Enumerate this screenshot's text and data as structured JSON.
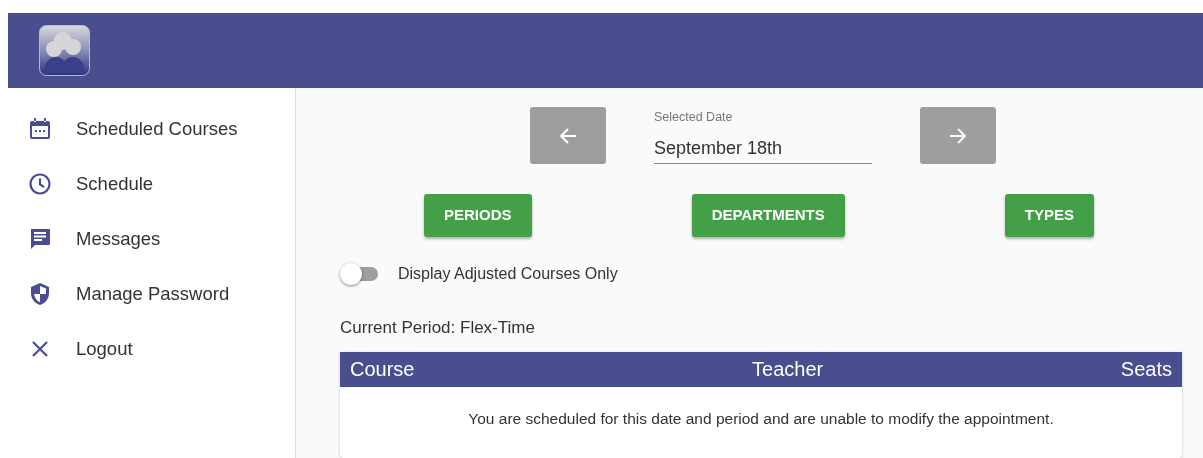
{
  "sidebar": {
    "items": [
      {
        "label": "Scheduled Courses"
      },
      {
        "label": "Schedule"
      },
      {
        "label": "Messages"
      },
      {
        "label": "Manage Password"
      },
      {
        "label": "Logout"
      }
    ]
  },
  "date_picker": {
    "label": "Selected Date",
    "value": "September 18th"
  },
  "filter_buttons": [
    "PERIODS",
    "DEPARTMENTS",
    "TYPES"
  ],
  "toggle": {
    "label": "Display Adjusted Courses Only",
    "on": false
  },
  "current_period": "Current Period: Flex-Time",
  "table": {
    "columns": [
      "Course",
      "Teacher",
      "Seats"
    ],
    "message": "You are scheduled for this date and period and are unable to modify the appointment."
  }
}
